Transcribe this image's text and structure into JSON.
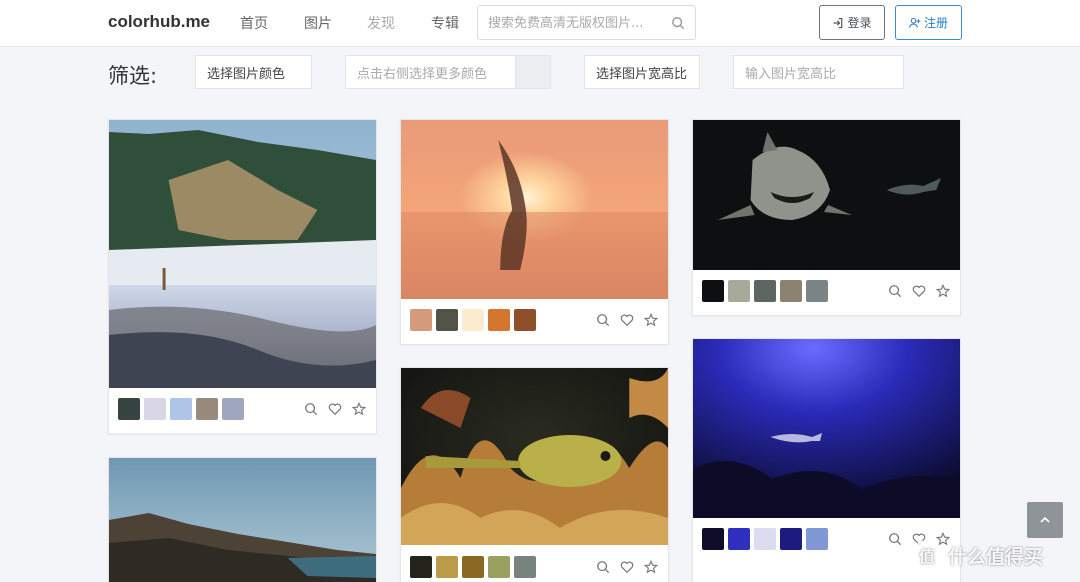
{
  "header": {
    "brand": "colorhub.me",
    "nav": [
      {
        "label": "首页"
      },
      {
        "label": "图片"
      },
      {
        "label": "发现"
      },
      {
        "label": "专辑"
      }
    ],
    "search_placeholder": "搜索免费高清无版权图片...",
    "login_label": "登录",
    "signup_label": "注册"
  },
  "filter": {
    "label": "筛选:",
    "color_select": "选择图片颜色",
    "more_colors_placeholder": "点击右侧选择更多颜色",
    "ratio_select": "选择图片宽高比",
    "ratio_input_placeholder": "输入图片宽高比"
  },
  "cards": [
    {
      "name": "beach-cliff",
      "swatches": [
        "#384442",
        "#d9d6e6",
        "#b0c4e8",
        "#9a8a7c",
        "#9fa7c0"
      ]
    },
    {
      "name": "sunset-hair",
      "swatches": [
        "#d59a7c",
        "#535447",
        "#fcebd1",
        "#d5752f",
        "#8f4f2a"
      ]
    },
    {
      "name": "shark",
      "swatches": [
        "#0d0f10",
        "#a7a99a",
        "#5c6761",
        "#8c8270",
        "#7b8587"
      ]
    },
    {
      "name": "yellow-fish",
      "swatches": [
        "#242219",
        "#b99b4a",
        "#8a6a23",
        "#98a160",
        "#78837e"
      ]
    },
    {
      "name": "underwater-blue",
      "swatches": [
        "#0e0e2a",
        "#2f2fc0",
        "#dcdcf0",
        "#1c1c7e",
        "#8098d6"
      ]
    },
    {
      "name": "rocky-coast",
      "swatches": []
    }
  ],
  "watermark": {
    "glyph": "值",
    "text": "什么值得买"
  },
  "icons": {
    "search": "search-icon",
    "heart": "heart-icon",
    "star": "star-icon",
    "login": "login-icon",
    "signup": "user-plus-icon",
    "to_top": "chevron-up-icon"
  }
}
